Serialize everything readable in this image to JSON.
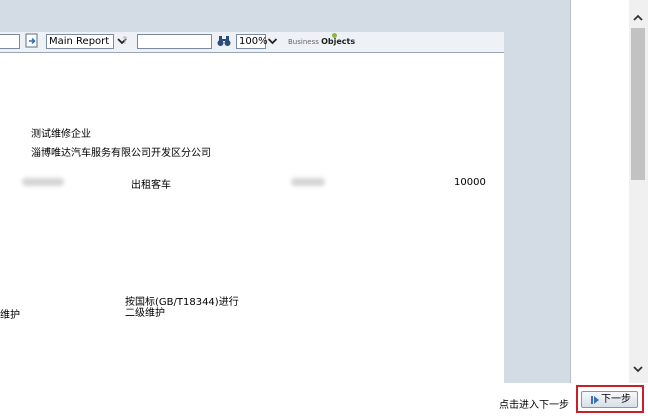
{
  "toolbar": {
    "report_select": "Main Report",
    "zoom_select": "100%",
    "logo_text_1": "Business",
    "logo_text_2": "Objects"
  },
  "report": {
    "company_line_1": "测试维修企业",
    "company_line_2": "淄博唯达汽车服务有限公司开发区分公司",
    "vehicle_type": "出租客车",
    "amount": "10000",
    "maintenance_left": "维护",
    "standard_line_1": "按国标(GB/T18344)进行",
    "standard_line_2": "二级维护"
  },
  "footer": {
    "hint": "点击进入下一步",
    "next_button": "下一步"
  },
  "colors": {
    "highlight": "#c8202a",
    "frame_bg": "#d3dbe5"
  }
}
